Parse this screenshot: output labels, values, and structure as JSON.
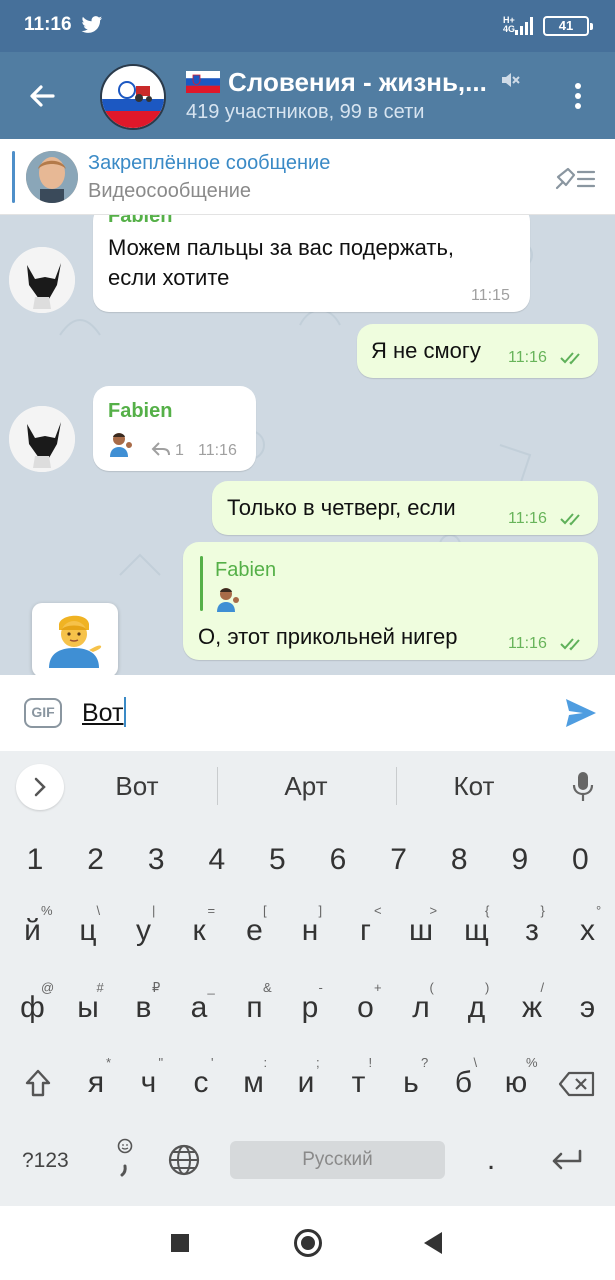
{
  "status_bar": {
    "time": "11:16",
    "network": "H+",
    "network_sub": "4G",
    "battery": "41"
  },
  "header": {
    "title": "Словения - жизнь,...",
    "subtitle": "419 участников, 99 в сети"
  },
  "pinned": {
    "title": "Закреплённое сообщение",
    "subtitle": "Видеосообщение"
  },
  "messages": [
    {
      "sender": "Fabien",
      "text_line1": "Можем пальцы за вас подержать,",
      "text_line2": "если хотите",
      "time": "11:15"
    },
    {
      "text": "Я не смогу",
      "time": "11:16"
    },
    {
      "sender": "Fabien",
      "reply_count": "1",
      "time": "11:16"
    },
    {
      "text": "Только в четверг, если",
      "time": "11:16"
    },
    {
      "reply_sender": "Fabien",
      "text": "О, этот прикольней нигер",
      "time": "11:16"
    }
  ],
  "input": {
    "value": "Вот"
  },
  "keyboard": {
    "suggestions": [
      "Вот",
      "Арт",
      "Кот"
    ],
    "row_digits": [
      "1",
      "2",
      "3",
      "4",
      "5",
      "6",
      "7",
      "8",
      "9",
      "0"
    ],
    "row1": [
      "й",
      "ц",
      "у",
      "к",
      "е",
      "н",
      "г",
      "ш",
      "щ",
      "з",
      "х"
    ],
    "row1_hints": [
      "%",
      "\\",
      "|",
      "=",
      "[",
      "]",
      "<",
      ">",
      "{",
      "}",
      "°"
    ],
    "row2": [
      "ф",
      "ы",
      "в",
      "а",
      "п",
      "р",
      "о",
      "л",
      "д",
      "ж",
      "э"
    ],
    "row2_hints": [
      "@",
      "#",
      "₽",
      "_",
      "&",
      "-",
      "+",
      "(",
      ")",
      "/",
      ""
    ],
    "row3": [
      "я",
      "ч",
      "с",
      "м",
      "и",
      "т",
      "ь",
      "б",
      "ю"
    ],
    "row3_hints": [
      "*",
      "\"",
      "'",
      ":",
      ";",
      "!",
      "?",
      "\\",
      "%"
    ],
    "symbols_key": "?123",
    "space_label": "Русский",
    "period_key": "."
  },
  "colors": {
    "header": "#517da2",
    "status_bar": "#46709a",
    "accent_green": "#55b048",
    "link_blue": "#3a8ac6"
  }
}
